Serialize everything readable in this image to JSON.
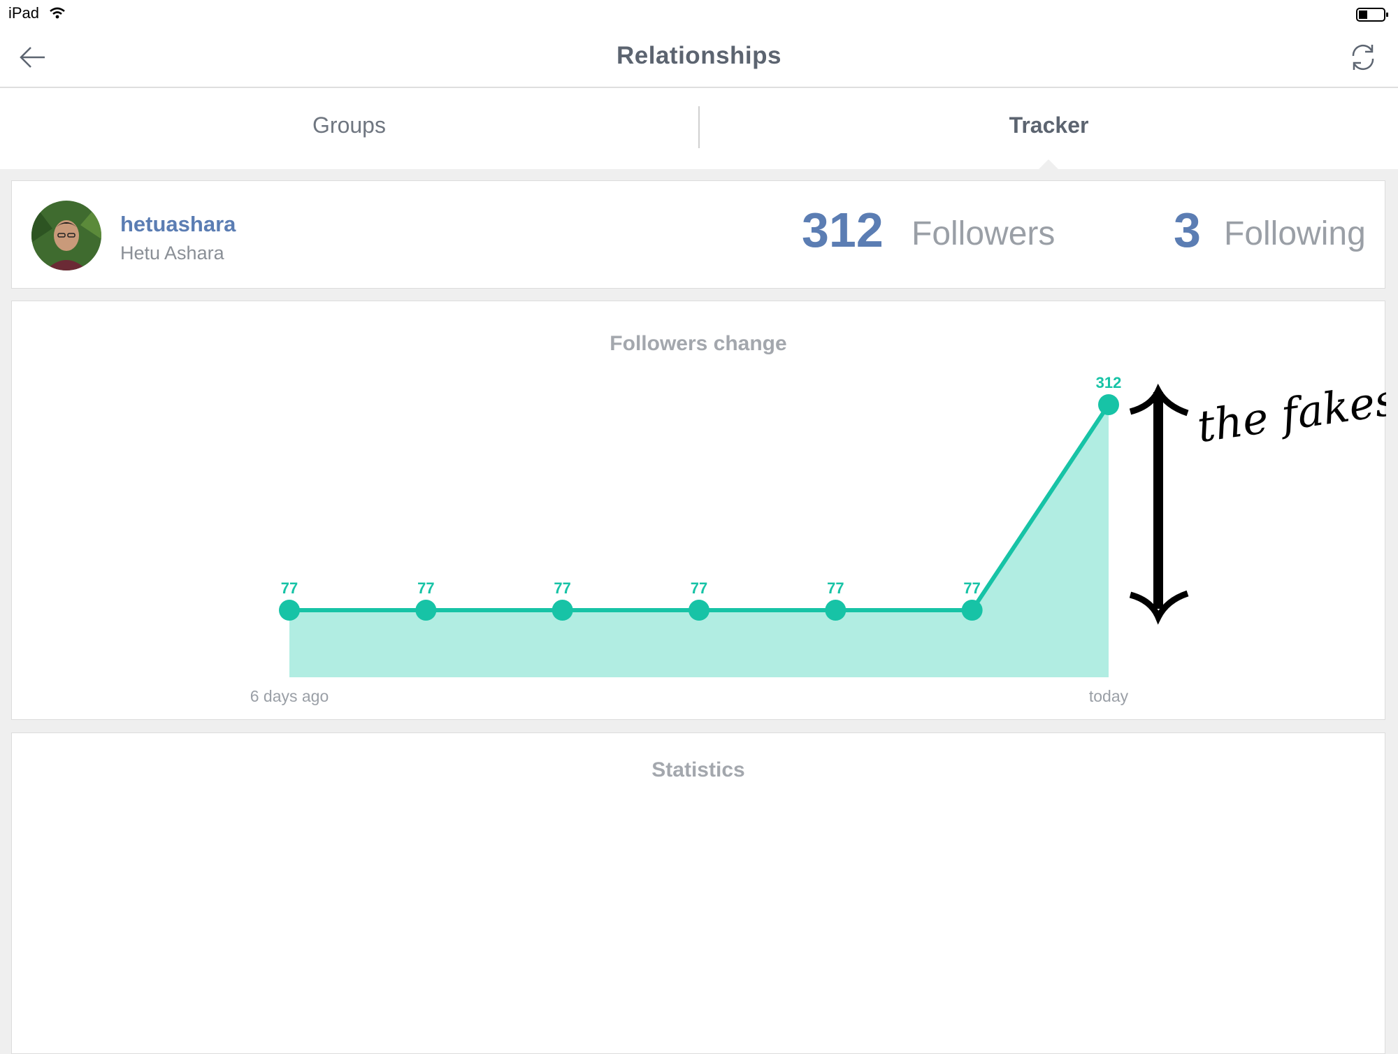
{
  "status_bar": {
    "device": "iPad"
  },
  "nav": {
    "title": "Relationships"
  },
  "tabs": {
    "groups": "Groups",
    "tracker": "Tracker",
    "active": "Tracker"
  },
  "profile": {
    "username": "hetuashara",
    "full_name": "Hetu Ashara",
    "followers_count": "312",
    "followers_label": "Followers",
    "following_count": "3",
    "following_label": "Following"
  },
  "chart_section": {
    "title": "Followers change"
  },
  "statistics": {
    "title": "Statistics"
  },
  "annotation": {
    "text": "the fakes"
  },
  "colors": {
    "accent": "#5b7db3",
    "series": "#17c3a6",
    "area": "#b1ede2"
  },
  "chart_data": {
    "type": "area",
    "title": "Followers change",
    "x": [
      "6 days ago",
      "",
      "",
      "",
      "",
      "",
      "today"
    ],
    "x_tick_labels": [
      "6 days ago",
      "today"
    ],
    "series": [
      {
        "values": [
          77,
          77,
          77,
          77,
          77,
          77,
          312
        ]
      }
    ],
    "data_labels": [
      "77",
      "77",
      "77",
      "77",
      "77",
      "77",
      "312"
    ],
    "ylim": [
      0,
      312
    ],
    "grid": false,
    "legend": "none"
  }
}
